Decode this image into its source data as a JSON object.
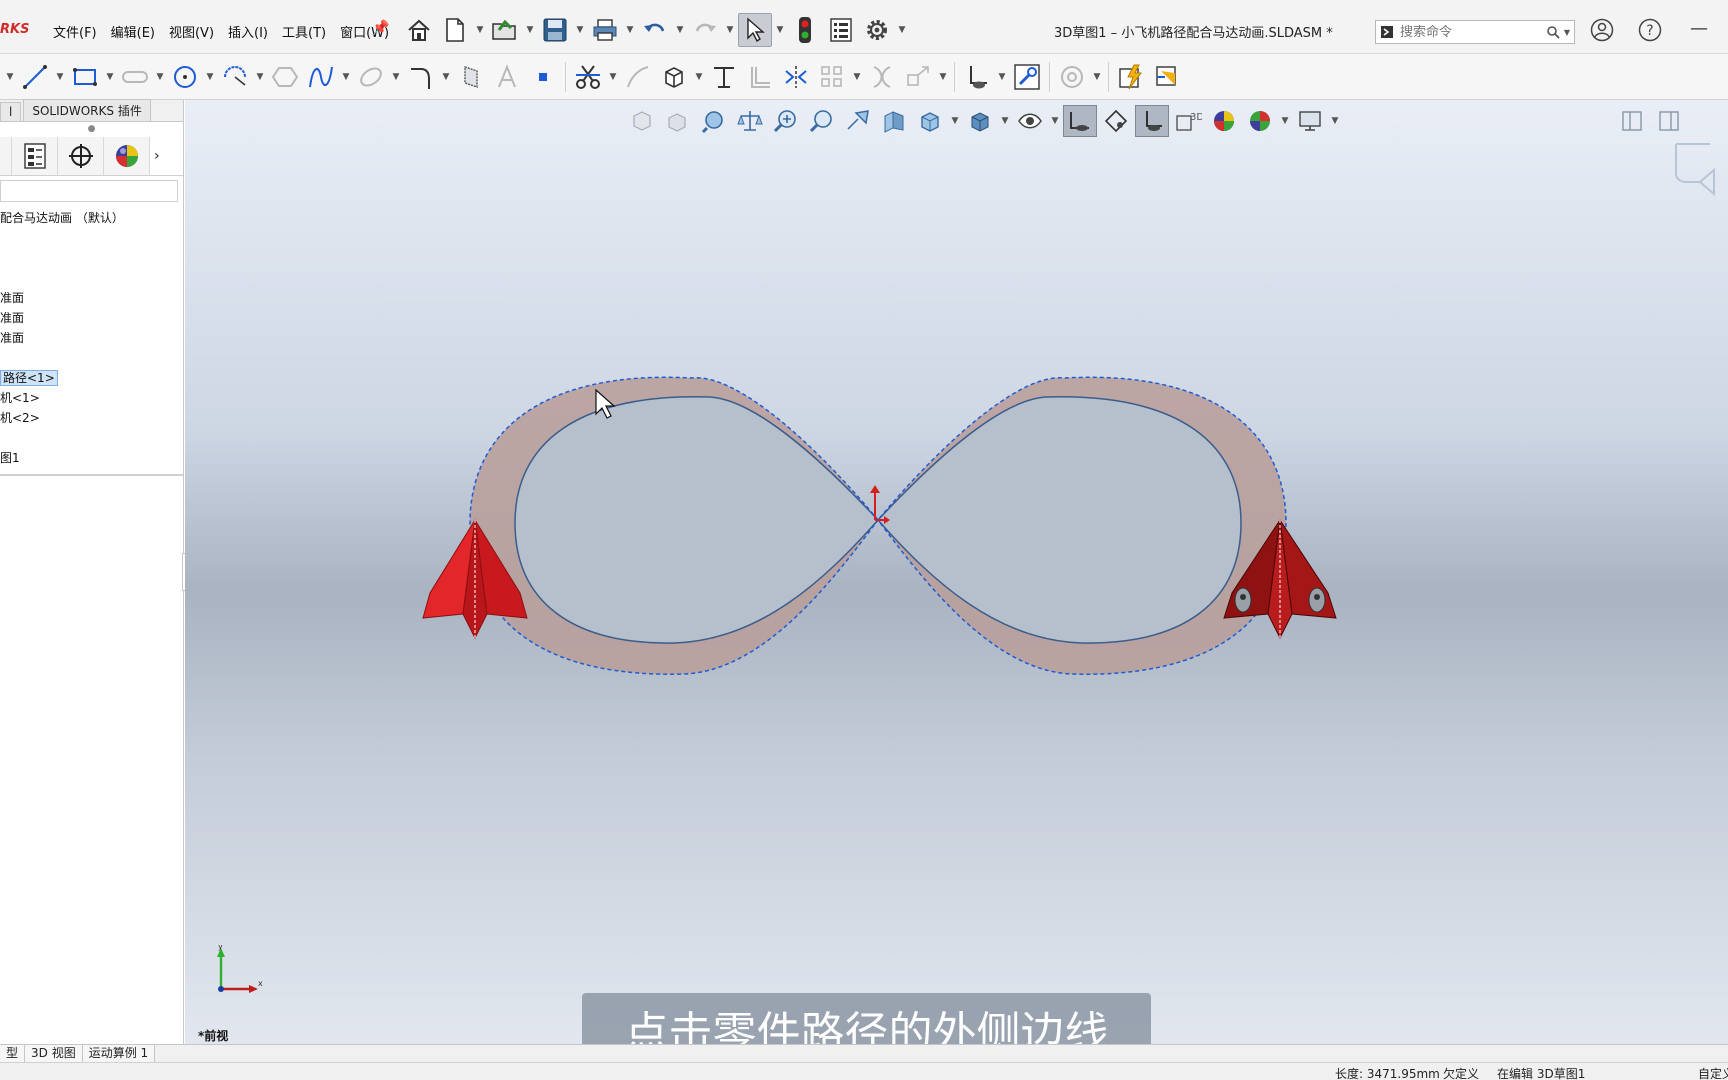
{
  "app": {
    "brand": "RKS",
    "title": "3D草图1 – 小飞机路径配合马达动画.SLDASM *"
  },
  "menus": [
    "文件(F)",
    "编辑(E)",
    "视图(V)",
    "插入(I)",
    "工具(T)",
    "窗口(W)"
  ],
  "search": {
    "placeholder": "搜索命令"
  },
  "commandmanager_tabs": [
    "l",
    "SOLIDWORKS 插件"
  ],
  "tree": {
    "items": [
      {
        "label": "配合马达动画 （默认）",
        "selected": false
      },
      {
        "label": "",
        "selected": false
      },
      {
        "label": "",
        "selected": false
      },
      {
        "label": "",
        "selected": false
      },
      {
        "label": "准面",
        "selected": false
      },
      {
        "label": "准面",
        "selected": false
      },
      {
        "label": "准面",
        "selected": false
      },
      {
        "label": "",
        "selected": false
      },
      {
        "label": "路径<1>",
        "selected": true
      },
      {
        "label": "机<1>",
        "selected": false
      },
      {
        "label": "机<2>",
        "selected": false
      },
      {
        "label": "",
        "selected": false
      },
      {
        "label": "图1",
        "selected": false
      }
    ]
  },
  "viewport": {
    "view_name": "*前视",
    "subtitle": "点击零件路径的外侧边线",
    "triad_x": "x",
    "triad_y": "y"
  },
  "bottom_tabs": [
    "型",
    "3D 视图",
    "运动算例 1"
  ],
  "status": {
    "length": "长度: 3471.95mm",
    "defined": "欠定义",
    "editing": "在编辑 3D草图1",
    "custom": "自定义"
  },
  "colors": {
    "accent": "#d12c2c",
    "path_fill": "#b9a09c",
    "plane_red": "#d81f1f",
    "plane_dark": "#8f1212",
    "selection_blue": "#1e5bd6"
  }
}
